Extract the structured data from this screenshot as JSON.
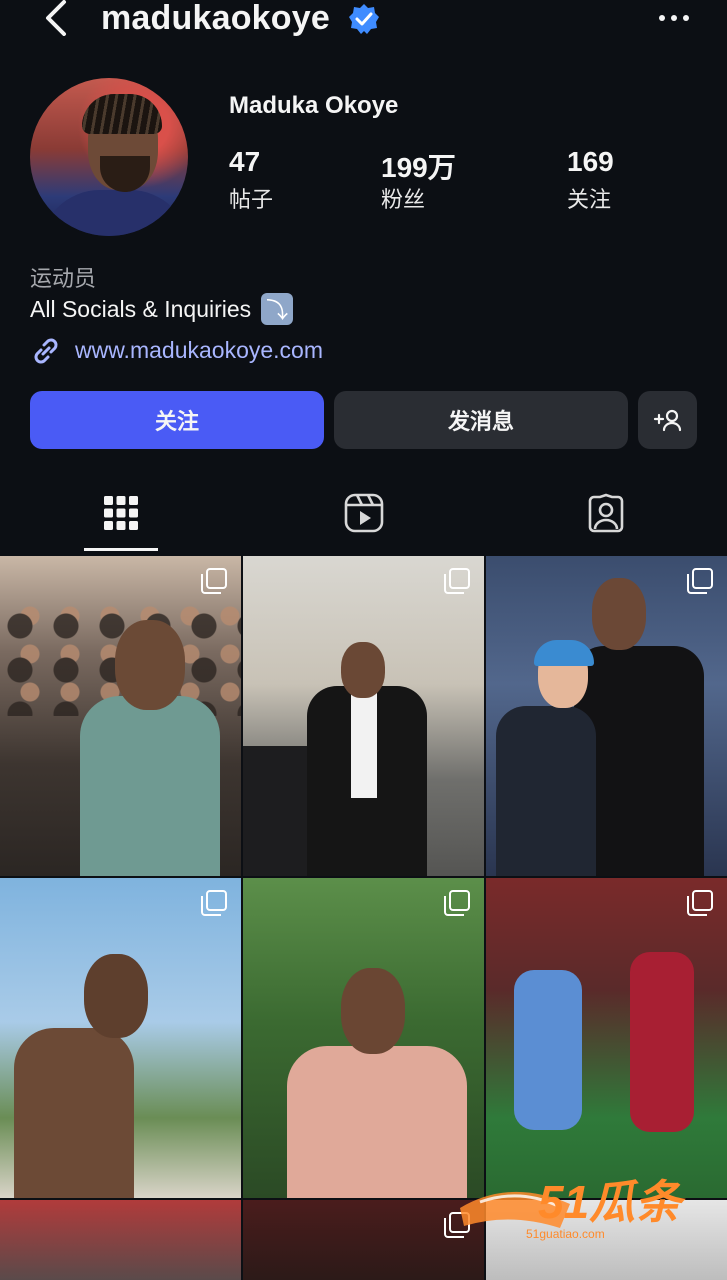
{
  "header": {
    "username": "madukaokoye",
    "verified": true
  },
  "profile": {
    "full_name": "Maduka Okoye",
    "stats": [
      {
        "value": "47",
        "label": "帖子"
      },
      {
        "value": "199万",
        "label": "粉丝"
      },
      {
        "value": "169",
        "label": "关注"
      }
    ],
    "category": "运动员",
    "bio": "All Socials & Inquiries",
    "bio_emoji": "⤵",
    "link": "www.madukaokoye.com"
  },
  "actions": {
    "follow": "关注",
    "message": "发消息",
    "add_user_icon": "add-person"
  },
  "tabs": [
    {
      "icon": "grid",
      "active": true
    },
    {
      "icon": "reels",
      "active": false
    },
    {
      "icon": "tagged",
      "active": false
    }
  ],
  "colors": {
    "background": "#0c0f14",
    "accent": "#4a5bf5",
    "link": "#a9b6ff",
    "verified": "#3f8cff"
  },
  "watermark": {
    "brand": "51瓜条",
    "url": "51guatiao.com"
  }
}
